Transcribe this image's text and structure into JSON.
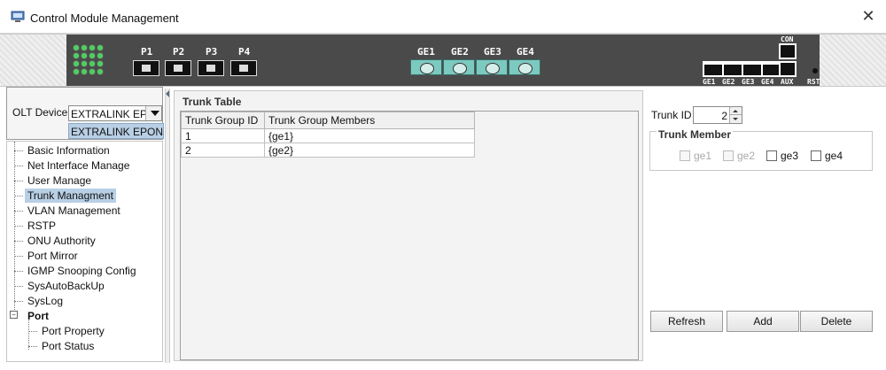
{
  "window": {
    "title": "Control Module Management",
    "app_icon": "computer-icon",
    "close_icon": "close-icon",
    "close_glyph": "✕"
  },
  "device": {
    "pon_ports": [
      "P1",
      "P2",
      "P3",
      "P4"
    ],
    "ge_sfp_ports": [
      "GE1",
      "GE2",
      "GE3",
      "GE4"
    ],
    "rear_labels": [
      "GE1",
      "GE2",
      "GE3",
      "GE4",
      "AUX",
      "RST"
    ],
    "console_label": "CON"
  },
  "olt": {
    "label": "OLT Device",
    "selected": "EXTRALINK EPON ...",
    "dropdown_option": "EXTRALINK EPON ..."
  },
  "nav": {
    "items": [
      {
        "label": "Basic Information"
      },
      {
        "label": "Net Interface Manage"
      },
      {
        "label": "User Manage"
      },
      {
        "label": "Trunk Managment",
        "selected": true
      },
      {
        "label": "VLAN Management"
      },
      {
        "label": "RSTP"
      },
      {
        "label": "ONU Authority"
      },
      {
        "label": "Port Mirror"
      },
      {
        "label": "IGMP Snooping Config"
      },
      {
        "label": "SysAutoBackUp"
      },
      {
        "label": "SysLog"
      }
    ],
    "port_group": {
      "label": "Port",
      "expanded": true,
      "children": [
        {
          "label": "Port Property"
        },
        {
          "label": "Port Status"
        }
      ]
    }
  },
  "trunk_table": {
    "title": "Trunk Table",
    "columns": [
      "Trunk Group ID",
      "Trunk Group Members"
    ],
    "rows": [
      [
        "1",
        "{ge1}"
      ],
      [
        "2",
        "{ge2}"
      ]
    ]
  },
  "trunk_form": {
    "trunk_id_label": "Trunk ID",
    "trunk_id_value": "2",
    "member_legend": "Trunk Member",
    "members": [
      {
        "label": "ge1",
        "checked": false,
        "enabled": false
      },
      {
        "label": "ge2",
        "checked": false,
        "enabled": false
      },
      {
        "label": "ge3",
        "checked": false,
        "enabled": true
      },
      {
        "label": "ge4",
        "checked": false,
        "enabled": true
      }
    ],
    "buttons": {
      "refresh": "Refresh",
      "add": "Add",
      "delete": "Delete"
    }
  }
}
